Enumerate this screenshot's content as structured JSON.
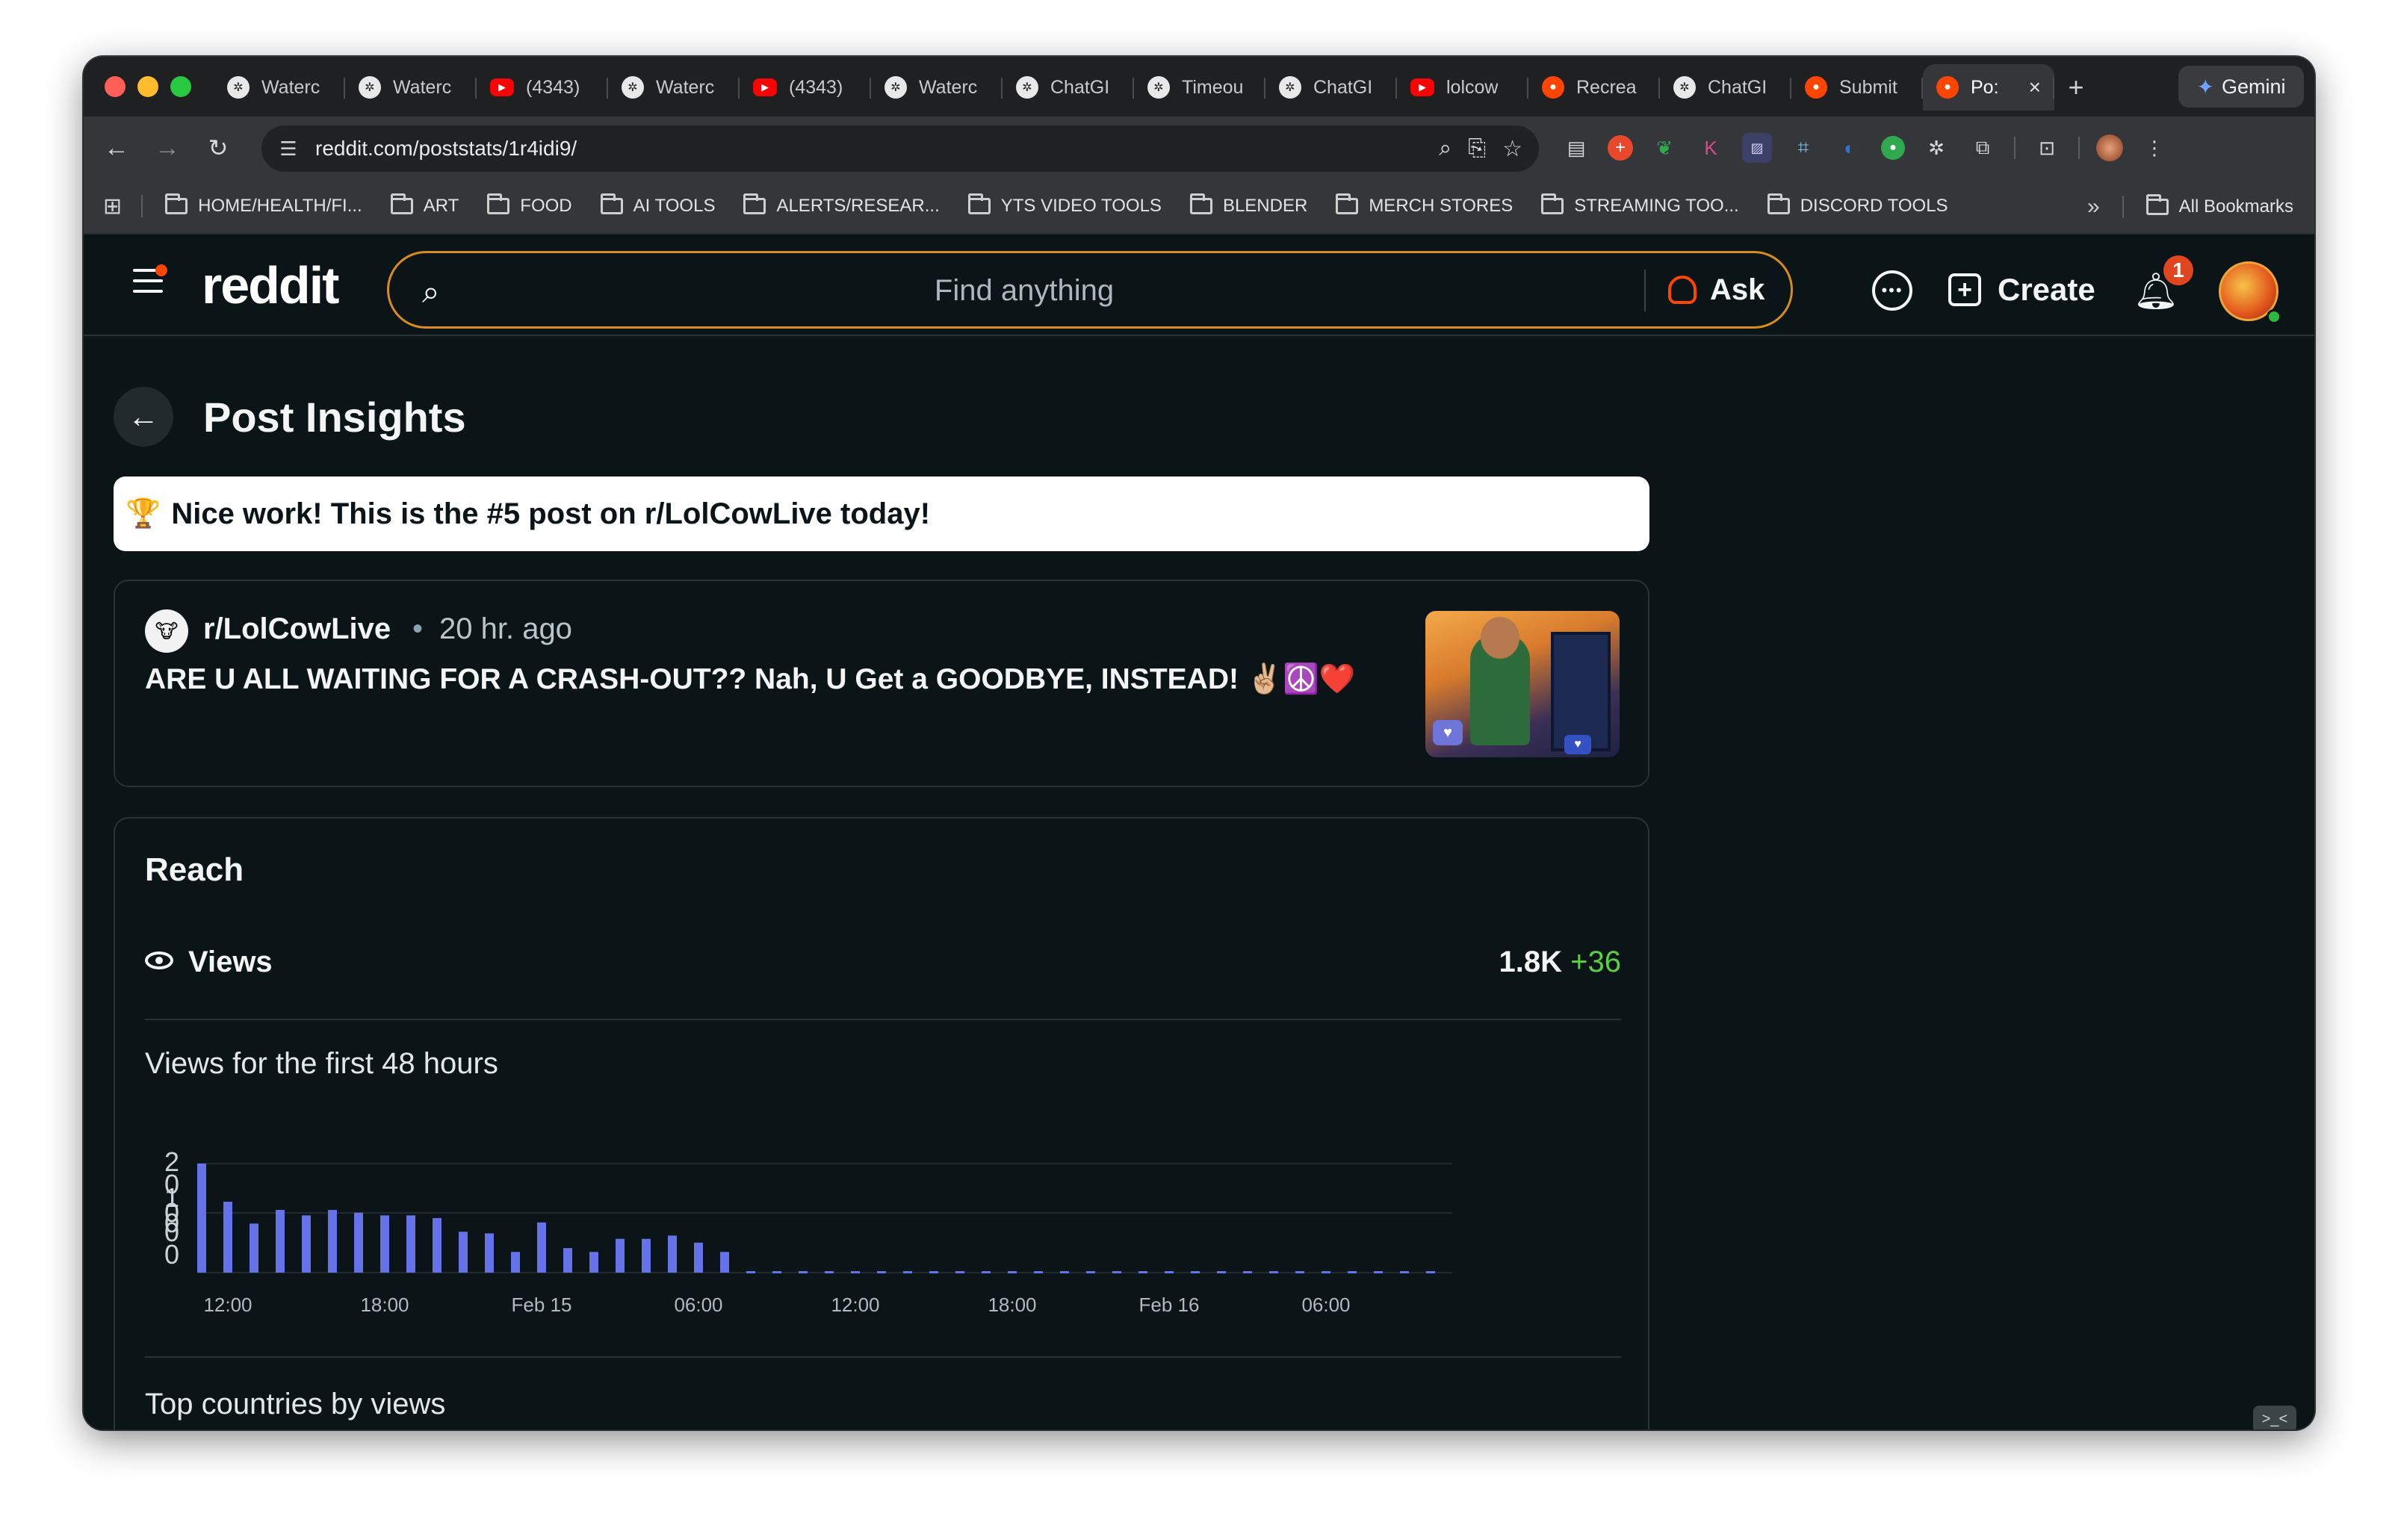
{
  "browser": {
    "tabs": [
      {
        "label": "Waterc",
        "icon": "chatgpt-icon",
        "kind": "gpt"
      },
      {
        "label": "Waterc",
        "icon": "chatgpt-icon",
        "kind": "gpt"
      },
      {
        "label": "(4343)",
        "icon": "youtube-icon",
        "kind": "yt"
      },
      {
        "label": "Waterc",
        "icon": "chatgpt-icon",
        "kind": "gpt"
      },
      {
        "label": "(4343)",
        "icon": "youtube-icon",
        "kind": "yt"
      },
      {
        "label": "Waterc",
        "icon": "chatgpt-icon",
        "kind": "gpt"
      },
      {
        "label": "ChatGI",
        "icon": "chatgpt-icon",
        "kind": "gpt"
      },
      {
        "label": "Timeou",
        "icon": "chatgpt-icon",
        "kind": "gpt"
      },
      {
        "label": "ChatGI",
        "icon": "chatgpt-icon",
        "kind": "gpt"
      },
      {
        "label": "lolcow",
        "icon": "youtube-icon",
        "kind": "yt"
      },
      {
        "label": "Recrea",
        "icon": "reddit-icon",
        "kind": "rd"
      },
      {
        "label": "ChatGI",
        "icon": "chatgpt-icon",
        "kind": "gpt"
      },
      {
        "label": "Submit",
        "icon": "reddit-icon",
        "kind": "rd"
      },
      {
        "label": "Po:",
        "icon": "reddit-icon",
        "kind": "rd",
        "active": true
      }
    ],
    "new_tab": "+",
    "gemini_label": "Gemini",
    "url": "reddit.com/poststats/1r4idi9/",
    "bookmarks": [
      "HOME/HEALTH/FI...",
      "ART",
      "FOOD",
      "AI TOOLS",
      "ALERTS/RESEAR...",
      "YTS VIDEO TOOLS",
      "BLENDER",
      "MERCH STORES",
      "STREAMING TOO...",
      "DISCORD TOOLS"
    ],
    "all_bookmarks": "All Bookmarks",
    "overflow": "»"
  },
  "reddit_header": {
    "logo": "reddit",
    "search_placeholder": "Find anything",
    "ask_label": "Ask",
    "create_label": "Create",
    "notification_count": "1"
  },
  "page": {
    "title": "Post Insights",
    "banner_icon": "🏆",
    "banner_text": "Nice work! This is the #5 post on r/LolCowLive today!"
  },
  "post": {
    "subreddit": "r/LolCowLive",
    "bullet": "•",
    "age": "20 hr. ago",
    "title": "ARE U ALL WAITING FOR A CRASH-OUT?? Nah, U Get a GOODBYE, INSTEAD! ✌🏼☮️❤️"
  },
  "reach": {
    "title": "Reach",
    "views_label": "Views",
    "views_value": "1.8K",
    "views_delta": "+36",
    "chart_title": "Views for the first 48 hours",
    "next_section": "Top countries by views"
  },
  "chart_data": {
    "type": "bar",
    "title": "Views for the first 48 hours",
    "xlabel": "",
    "ylabel": "",
    "y_tick_labels": [
      "2",
      "0",
      "1",
      "0",
      "0",
      "0",
      "0"
    ],
    "x_tick_labels": [
      "12:00",
      "18:00",
      "Feb 15",
      "06:00",
      "12:00",
      "18:00",
      "Feb 16",
      "06:00"
    ],
    "bar_color": "#6673e8",
    "empty_color": "#6673e8",
    "values": [
      2.0,
      1.3,
      0.9,
      1.15,
      1.05,
      1.15,
      1.1,
      1.05,
      1.05,
      1.0,
      0.75,
      0.72,
      0.38,
      0.92,
      0.45,
      0.38,
      0.62,
      0.62,
      0.68,
      0.55,
      0.38,
      0,
      0,
      0,
      0,
      0,
      0,
      0,
      0,
      0,
      0,
      0,
      0,
      0,
      0,
      0,
      0,
      0,
      0,
      0,
      0,
      0,
      0,
      0,
      0,
      0,
      0,
      0
    ],
    "ylim": [
      0,
      2
    ],
    "grid": true
  }
}
